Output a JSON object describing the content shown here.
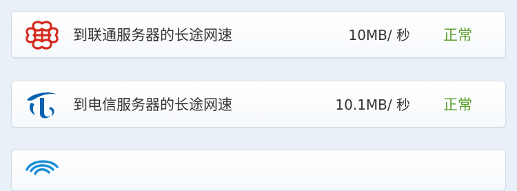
{
  "colors": {
    "background": "#e9f0f7",
    "status_ok": "#5aa02c",
    "unicom_red": "#d42a1e",
    "telecom_blue": "#0d62b0",
    "mobile_blue": "#1a8fd6"
  },
  "tests": [
    {
      "icon": "china-unicom-logo-icon",
      "label": "到联通服务器的长途网速",
      "speed": "10MB/ 秒",
      "status": "正常"
    },
    {
      "icon": "china-telecom-logo-icon",
      "label": "到电信服务器的长途网速",
      "speed": "10.1MB/ 秒",
      "status": "正常"
    },
    {
      "icon": "china-mobile-logo-icon"
    }
  ]
}
